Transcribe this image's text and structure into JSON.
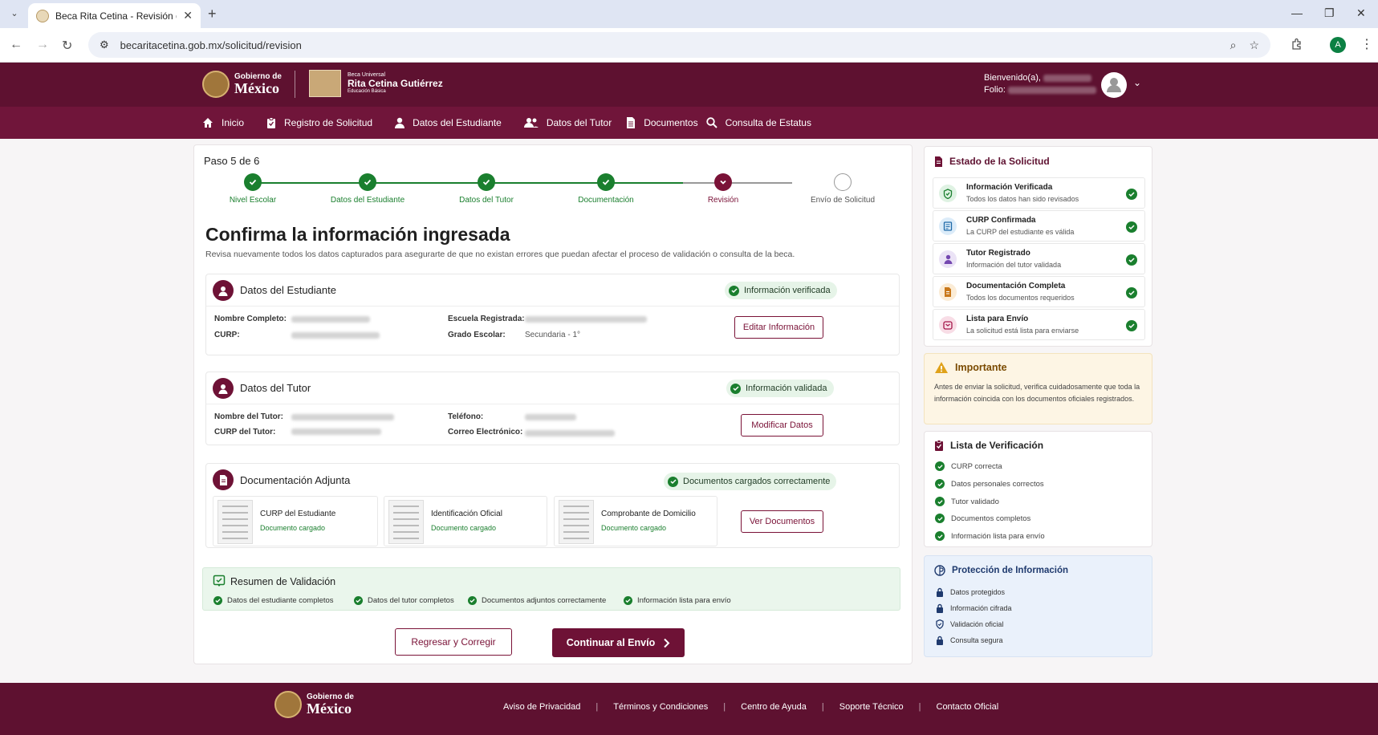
{
  "browser": {
    "tab_title": "Beca Rita Cetina - Revisión de So",
    "url": "becaritacetina.gob.mx/solicitud/revision",
    "profile_initial": "A"
  },
  "header": {
    "gob_line1": "Gobierno de",
    "gob_line2": "México",
    "beca_line1": "Beca Universal",
    "beca_line2": "Rita Cetina Gutiérrez",
    "beca_line3": "Educación Básica",
    "welcome": "Bienvenido(a),",
    "folio": "Folio:"
  },
  "nav": [
    {
      "label": "Inicio",
      "icon": "home-icon"
    },
    {
      "label": "Registro de Solicitud",
      "icon": "clipboard-icon"
    },
    {
      "label": "Datos del Estudiante",
      "icon": "user-icon"
    },
    {
      "label": "Datos del Tutor",
      "icon": "users-icon"
    },
    {
      "label": "Documentos",
      "icon": "document-icon"
    },
    {
      "label": "Consulta de Estatus",
      "icon": "search-icon"
    }
  ],
  "main": {
    "paso": "Paso 5 de 6",
    "steps": [
      {
        "label": "Nivel Escolar",
        "status": "done"
      },
      {
        "label": "Datos del Estudiante",
        "status": "done"
      },
      {
        "label": "Datos del Tutor",
        "status": "done"
      },
      {
        "label": "Documentación",
        "status": "done"
      },
      {
        "label": "Revisión",
        "status": "current"
      },
      {
        "label": "Envío de Solicitud",
        "status": "pending"
      }
    ],
    "title": "Confirma la información ingresada",
    "subtitle": "Revisa nuevamente todos los datos capturados para asegurarte de que no existan errores que puedan afectar el proceso de validación o consulta de la beca.",
    "student": {
      "title": "Datos del Estudiante",
      "badge": "Información verificada",
      "nombre_label": "Nombre Completo:",
      "curp_label": "CURP:",
      "escuela_label": "Escuela Registrada:",
      "grado_label": "Grado Escolar:",
      "grado_value": "Secundaria - 1°",
      "button": "Editar Información"
    },
    "tutor": {
      "title": "Datos del Tutor",
      "badge": "Información validada",
      "nombre_label": "Nombre del Tutor:",
      "curp_label": "CURP del Tutor:",
      "telefono_label": "Teléfono:",
      "correo_label": "Correo Electrónico:",
      "button": "Modificar Datos"
    },
    "docs": {
      "title": "Documentación Adjunta",
      "badge": "Documentos cargados correctamente",
      "items": [
        {
          "title": "CURP del Estudiante",
          "status": "Documento cargado"
        },
        {
          "title": "Identificación Oficial",
          "status": "Documento cargado"
        },
        {
          "title": "Comprobante de Domicilio",
          "status": "Documento cargado"
        }
      ],
      "button": "Ver Documentos"
    },
    "resumen": {
      "title": "Resumen de Validación",
      "items": [
        "Datos del estudiante completos",
        "Datos del tutor completos",
        "Documentos adjuntos correctamente",
        "Información lista para envío"
      ]
    },
    "back_button": "Regresar y Corregir",
    "next_button": "Continuar al Envío"
  },
  "sidebar": {
    "estado": {
      "title": "Estado de la Solicitud",
      "items": [
        {
          "title": "Información Verificada",
          "sub": "Todos los datos han sido revisados",
          "icon": "shield-check-icon"
        },
        {
          "title": "CURP Confirmada",
          "sub": "La CURP del estudiante es válida",
          "icon": "id-card-icon"
        },
        {
          "title": "Tutor Registrado",
          "sub": "Información del tutor validada",
          "icon": "user-icon"
        },
        {
          "title": "Documentación Completa",
          "sub": "Todos los documentos requeridos",
          "icon": "file-icon"
        },
        {
          "title": "Lista para Envío",
          "sub": "La solicitud está lista para enviarse",
          "icon": "send-icon"
        }
      ]
    },
    "importante": {
      "title": "Importante",
      "body": "Antes de enviar la solicitud, verifica cuidadosamente que toda la información coincida con los documentos oficiales registrados."
    },
    "lista": {
      "title": "Lista de Verificación",
      "items": [
        "CURP correcta",
        "Datos personales correctos",
        "Tutor validado",
        "Documentos completos",
        "Información lista para envío"
      ]
    },
    "proteccion": {
      "title": "Protección de Información",
      "items": [
        "Datos protegidos",
        "Información cifrada",
        "Validación oficial",
        "Consulta segura"
      ]
    }
  },
  "footer": {
    "gob_line1": "Gobierno de",
    "gob_line2": "México",
    "links": [
      "Aviso de Privacidad",
      "Términos y Condiciones",
      "Centro de Ayuda",
      "Soporte Técnico",
      "Contacto Oficial"
    ]
  },
  "colors": {
    "brand": "#5e1130",
    "nav": "#70153a",
    "success": "#1a7f2e"
  }
}
